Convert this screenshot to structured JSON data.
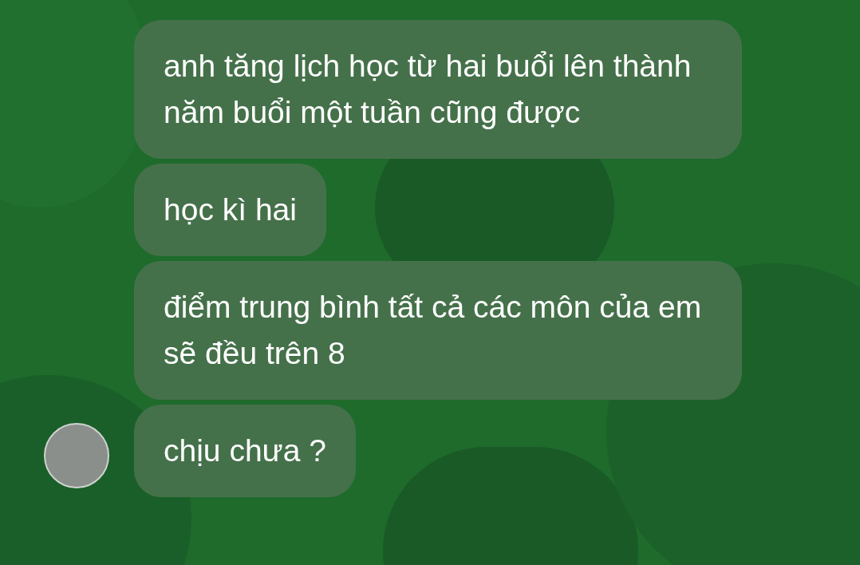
{
  "messages": [
    {
      "text": "anh tăng lịch học từ hai buổi lên thành năm buổi một tuần cũng được",
      "avatar": false
    },
    {
      "text": "học kì hai",
      "avatar": false
    },
    {
      "text": "điểm trung bình tất cả các môn của em sẽ đều trên 8",
      "avatar": false
    },
    {
      "text": "chịu chưa ?",
      "avatar": true
    }
  ]
}
